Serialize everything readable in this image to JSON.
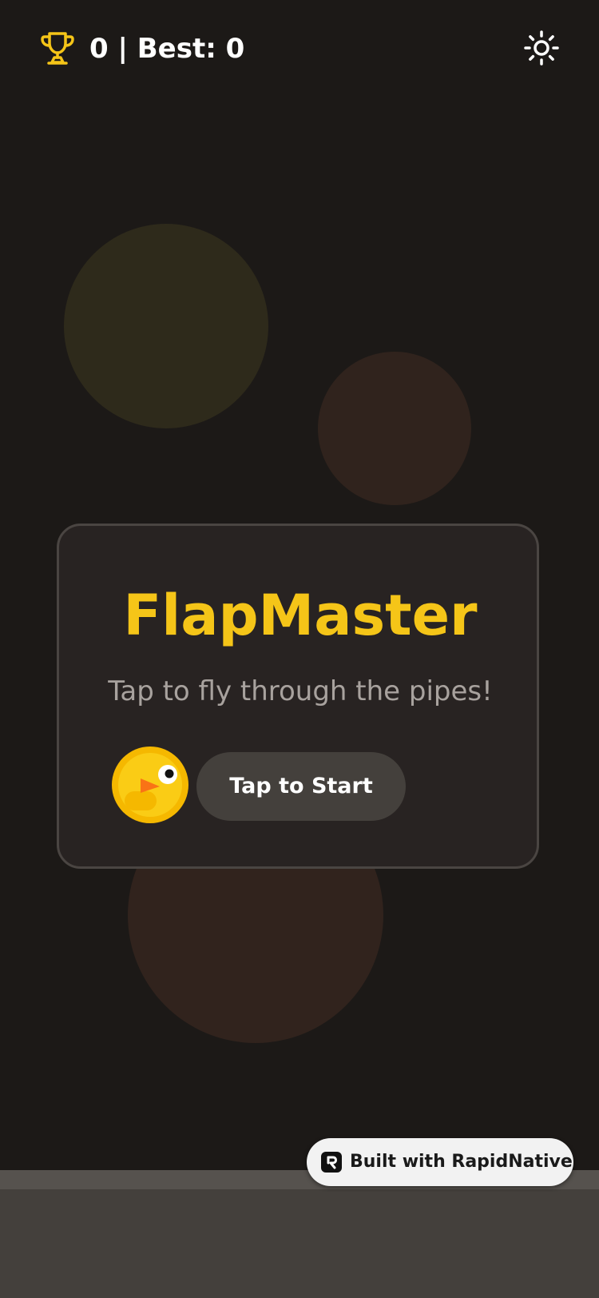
{
  "header": {
    "score_label": "0 | Best: 0",
    "trophy_icon": "trophy-icon",
    "settings_icon": "sun-icon"
  },
  "card": {
    "title": "FlapMaster",
    "subtitle": "Tap to fly through the pipes!",
    "start_label": "Tap to Start",
    "bird_icon": "bird-icon"
  },
  "badge": {
    "label": "Built with RapidNative",
    "logo_icon": "rapidnative-logo-icon"
  },
  "colors": {
    "background": "#1c1917",
    "accent": "#f5c518",
    "card": "#282322",
    "button": "#44403c",
    "ground": "#44403c"
  }
}
